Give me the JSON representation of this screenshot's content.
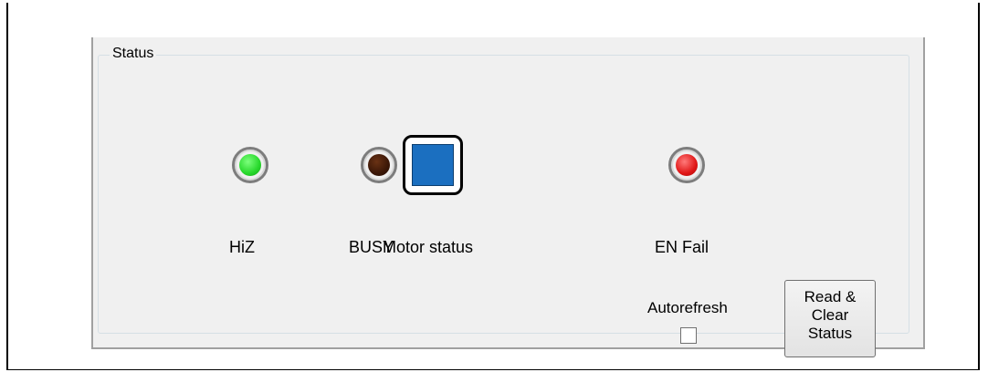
{
  "status_group": {
    "title": "Status"
  },
  "indicators": [
    {
      "label": "HiZ",
      "color": "#27d82b",
      "icon": "led-green-icon"
    },
    {
      "label": "BUSY",
      "color": "#3b1707",
      "icon": "led-dark-icon"
    },
    {
      "label": "Motor status",
      "color": "#1b6fc0",
      "icon": "motor-status-icon"
    },
    {
      "label": "EN Fail",
      "color": "#e01616",
      "icon": "led-red-icon"
    }
  ],
  "autorefresh": {
    "label": "Autorefresh",
    "checked": false
  },
  "read_clear_button": {
    "line1": "Read &",
    "line2": "Clear",
    "line3": "Status"
  }
}
